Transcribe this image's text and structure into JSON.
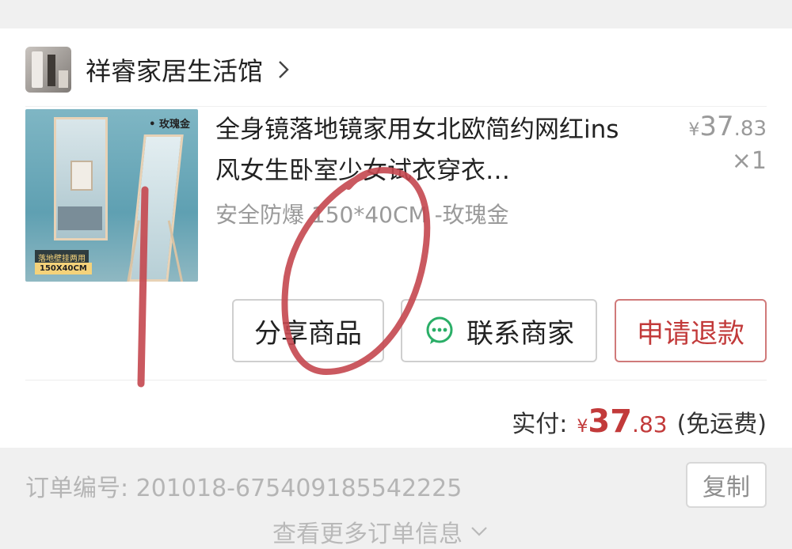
{
  "shop": {
    "name": "祥睿家居生活馆"
  },
  "product": {
    "title": "全身镜落地镜家用女北欧简约网红ins风女生卧室少女试衣穿衣…",
    "spec": "安全防爆 150*40CM -玫瑰金",
    "image_tag": "• 玫瑰金",
    "image_badge_1": "落地壁挂两用",
    "image_badge_2": "150X40CM",
    "price_currency": "¥",
    "price_int": "37",
    "price_dec": ".83",
    "quantity": "×1"
  },
  "actions": {
    "share_label": "分享商品",
    "contact_label": "联系商家",
    "refund_label": "申请退款"
  },
  "payment": {
    "label": "实付:",
    "currency": "¥",
    "amount_int": "37",
    "amount_dec": ".83",
    "shipping_note": "(免运费)"
  },
  "order": {
    "number_text": "订单编号: 201018-675409185542225",
    "copy_label": "复制",
    "more_label": "查看更多订单信息"
  },
  "icons": {
    "shop_chevron": "chevron-right-icon",
    "contact": "wechat-chat-icon",
    "more": "chevron-down-icon"
  },
  "colors": {
    "accent_red": "#c23a3a",
    "annotation_red": "#c4474f"
  }
}
